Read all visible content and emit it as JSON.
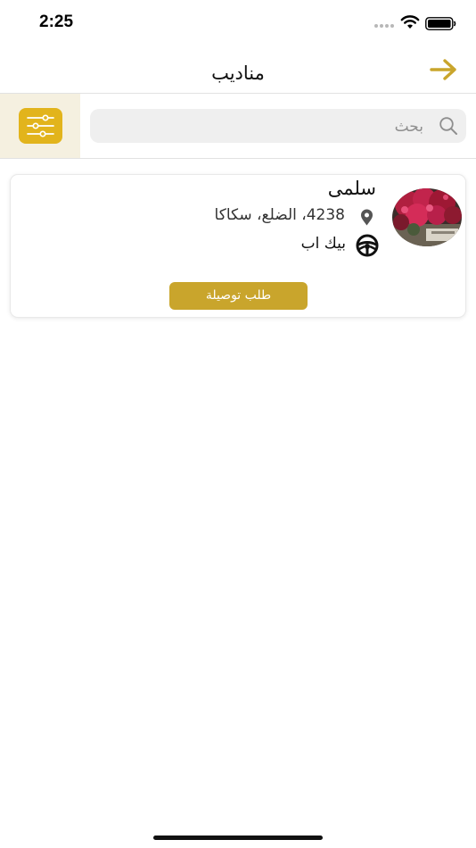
{
  "status_bar": {
    "time": "2:25"
  },
  "header": {
    "title": "مناديب",
    "back_icon": "arrow-right-icon",
    "accent_color": "#c9a52c"
  },
  "search": {
    "placeholder": "بحث",
    "value": "",
    "icon": "search-icon"
  },
  "filter": {
    "icon": "sliders-icon",
    "button_color": "#e2b41c",
    "panel_color": "#f5f0e0"
  },
  "drivers": [
    {
      "name": "سلمى",
      "address": "4238، الضلع، سكاكا",
      "car": "بيك اب",
      "action_label": "طلب توصيلة",
      "action_color": "#c9a52c"
    }
  ]
}
